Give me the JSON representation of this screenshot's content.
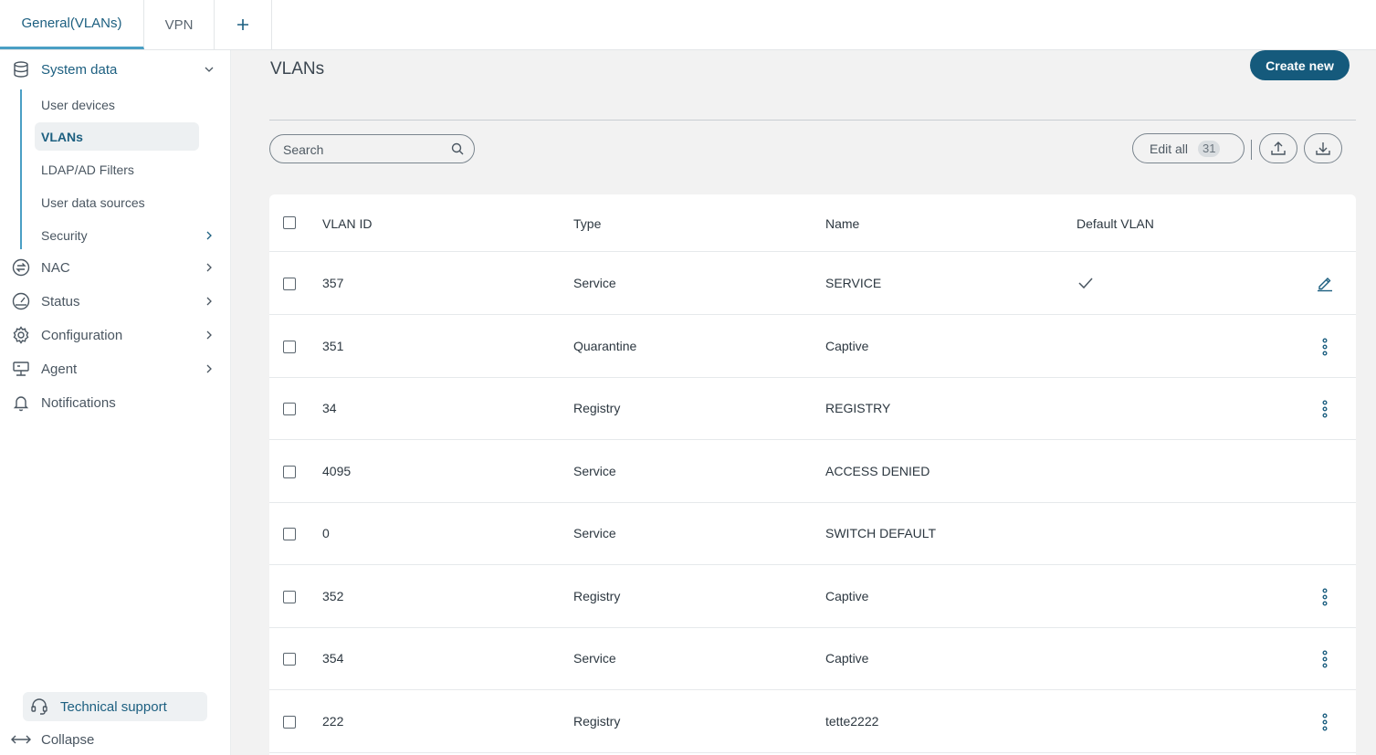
{
  "tabs": [
    {
      "label": "General(VLANs)",
      "active": true
    },
    {
      "label": "VPN",
      "active": false
    }
  ],
  "sidebar": {
    "system_data": {
      "label": "System data",
      "items": [
        {
          "label": "User devices"
        },
        {
          "label": "VLANs",
          "active": true
        },
        {
          "label": "LDAP/AD Filters"
        },
        {
          "label": "User data sources"
        },
        {
          "label": "Security"
        }
      ]
    },
    "sections": [
      {
        "label": "NAC",
        "icon": "swap-circle-icon"
      },
      {
        "label": "Status",
        "icon": "gauge-icon"
      },
      {
        "label": "Configuration",
        "icon": "gear-icon"
      },
      {
        "label": "Agent",
        "icon": "agent-icon"
      },
      {
        "label": "Notifications",
        "icon": "bell-icon"
      }
    ],
    "technical_support": "Technical support",
    "collapse": "Collapse"
  },
  "main": {
    "title": "VLANs",
    "create_button": "Create new",
    "search_placeholder": "Search",
    "edit_all_label": "Edit all",
    "edit_all_count": "31"
  },
  "table": {
    "columns": [
      "VLAN ID",
      "Type",
      "Name",
      "Default VLAN"
    ],
    "rows": [
      {
        "id": "357",
        "type": "Service",
        "name": "SERVICE",
        "default": true,
        "action": "edit"
      },
      {
        "id": "351",
        "type": "Quarantine",
        "name": "Captive",
        "default": false,
        "action": "menu"
      },
      {
        "id": "34",
        "type": "Registry",
        "name": "REGISTRY",
        "default": false,
        "action": "menu"
      },
      {
        "id": "4095",
        "type": "Service",
        "name": "ACCESS DENIED",
        "default": false,
        "action": "none"
      },
      {
        "id": "0",
        "type": "Service",
        "name": "SWITCH DEFAULT",
        "default": false,
        "action": "none"
      },
      {
        "id": "352",
        "type": "Registry",
        "name": "Captive",
        "default": false,
        "action": "menu"
      },
      {
        "id": "354",
        "type": "Service",
        "name": "Captive",
        "default": false,
        "action": "menu"
      },
      {
        "id": "222",
        "type": "Registry",
        "name": "tette2222",
        "default": false,
        "action": "menu"
      }
    ]
  },
  "colors": {
    "accent": "#155a7c",
    "tab_underline": "#4a9fc4"
  }
}
